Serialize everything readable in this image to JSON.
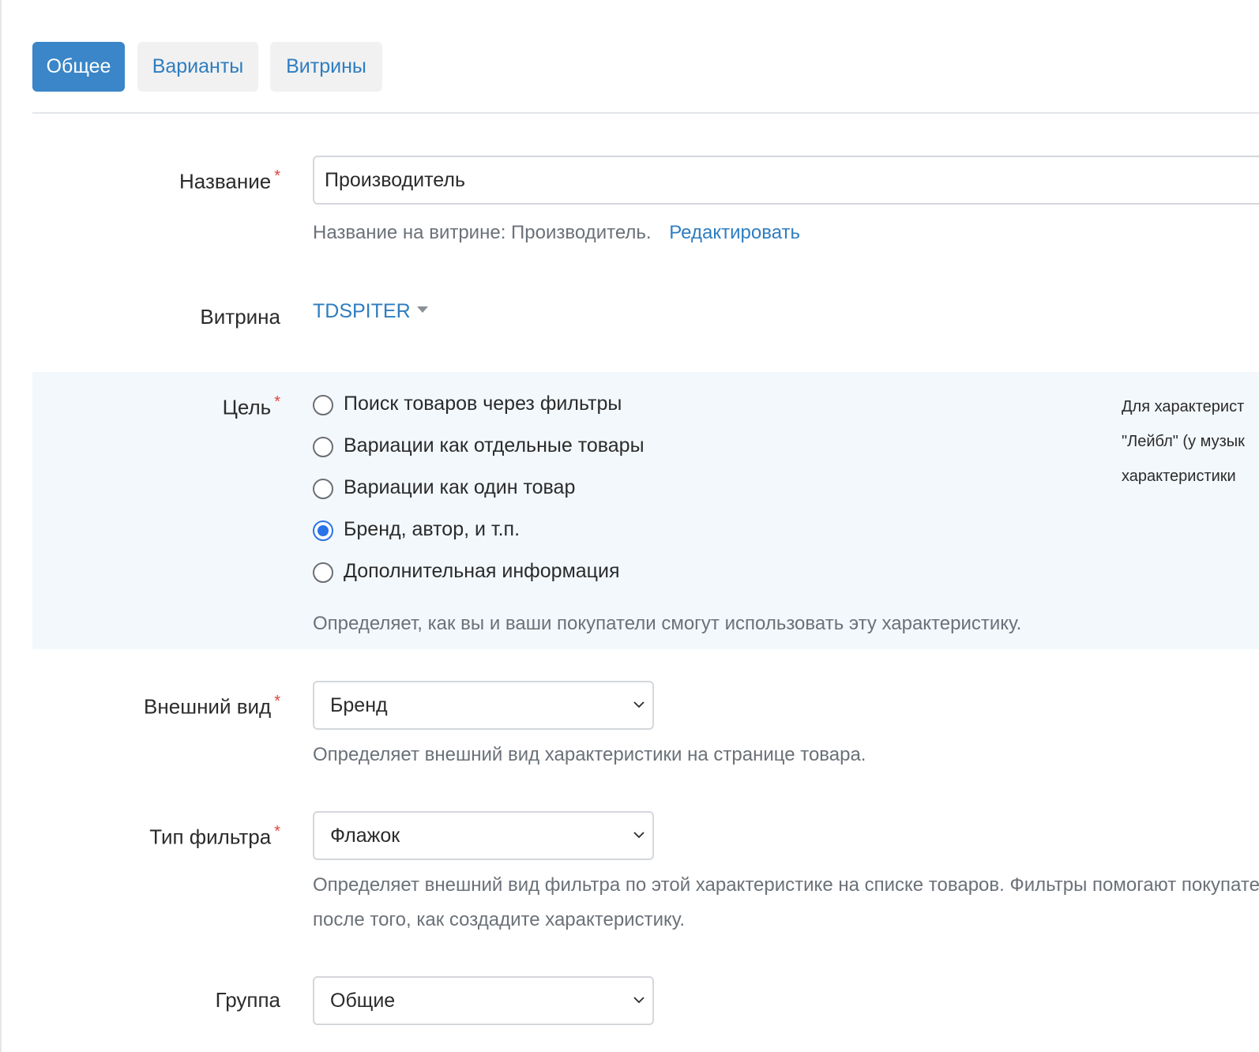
{
  "tabs": [
    {
      "label": "Общее",
      "active": true
    },
    {
      "label": "Варианты",
      "active": false
    },
    {
      "label": "Витрины",
      "active": false
    }
  ],
  "name_field": {
    "label": "Название",
    "value": "Производитель",
    "hint": "Название на витрине: Производитель.",
    "edit_link": "Редактировать"
  },
  "storefront": {
    "label": "Витрина",
    "value": "TDSPITER"
  },
  "purpose": {
    "label": "Цель",
    "options": [
      {
        "label": "Поиск товаров через фильтры",
        "checked": false
      },
      {
        "label": "Вариации как отдельные товары",
        "checked": false
      },
      {
        "label": "Вариации как один товар",
        "checked": false
      },
      {
        "label": "Бренд, автор, и т.п.",
        "checked": true
      },
      {
        "label": "Дополнительная информация",
        "checked": false
      }
    ],
    "hint": "Определяет, как вы и ваши покупатели смогут использовать эту характеристику.",
    "side_note": [
      "Для характерист",
      "\"Лейбл\" (у музык",
      "характеристики"
    ]
  },
  "appearance": {
    "label": "Внешний вид",
    "value": "Бренд",
    "hint": "Определяет внешний вид характеристики на странице товара."
  },
  "filter_type": {
    "label": "Тип фильтра",
    "value": "Флажок",
    "hint_line1": "Определяет внешний вид фильтра по этой характеристике на списке товаров. Фильтры помогают покупателям",
    "hint_line2": "после того, как создадите характеристику."
  },
  "group": {
    "label": "Группа",
    "value": "Общие"
  },
  "colors": {
    "accent": "#3a86c8",
    "link": "#2f7dc0",
    "required": "#e0443a",
    "panel_bg": "#f3f8fc",
    "radio_checked": "#2a73e8"
  }
}
